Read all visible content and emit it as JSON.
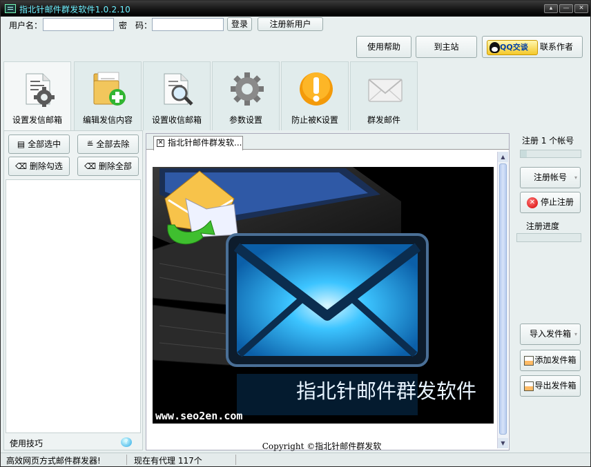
{
  "window": {
    "title": "指北针邮件群发软件1.0.2.10",
    "controls": [
      "▴",
      "—",
      "✕"
    ]
  },
  "login": {
    "username_label": "用户名：",
    "username_value": "",
    "password_label": "密　码：",
    "password_value": "",
    "login_button": "登录",
    "register_button": "注册新用户"
  },
  "top_links": {
    "help": "使用帮助",
    "main_site": "到主站",
    "qq_badge": "QQ交谈",
    "contact": "联系作者"
  },
  "toolbar": [
    {
      "label": "设置发信邮箱",
      "icon": "document-gear-icon",
      "active": true
    },
    {
      "label": "编辑发信内容",
      "icon": "folder-add-icon",
      "active": false
    },
    {
      "label": "设置收信邮箱",
      "icon": "document-search-icon",
      "active": false
    },
    {
      "label": "参数设置",
      "icon": "gear-icon",
      "active": false
    },
    {
      "label": "防止被K设置",
      "icon": "warning-icon",
      "active": false
    },
    {
      "label": "群发邮件",
      "icon": "envelope-icon",
      "active": false
    }
  ],
  "left_panel": {
    "select_all": "全部选中",
    "remove_all": "全部去除",
    "delete_checked": "删除勾选",
    "delete_all": "删除全部",
    "tips": "使用技巧"
  },
  "center": {
    "tab_label": "指北针邮件群发软...",
    "tab_close": "✕",
    "banner_title": "指北针邮件群发软件",
    "banner_url": "www.seo2en.com",
    "copyright": "Copyright ©指北针邮件群发软"
  },
  "right_panel": {
    "register_count_label": "注册 1 个帐号",
    "register_progress": 0.1,
    "register_account_button": "注册帐号",
    "stop_register_button": "停止注册",
    "progress_label": "注册进度",
    "progress_value": 0,
    "import_button": "导入发件箱",
    "add_button": "添加发件箱",
    "export_button": "导出发件箱"
  },
  "status": {
    "left": "高效网页方式邮件群发器!",
    "proxy": "现在有代理 117个"
  },
  "colors": {
    "title_text": "#6cf0ff",
    "panel_bg": "#e8efef",
    "envelope_glow": "#2fb7ff"
  }
}
